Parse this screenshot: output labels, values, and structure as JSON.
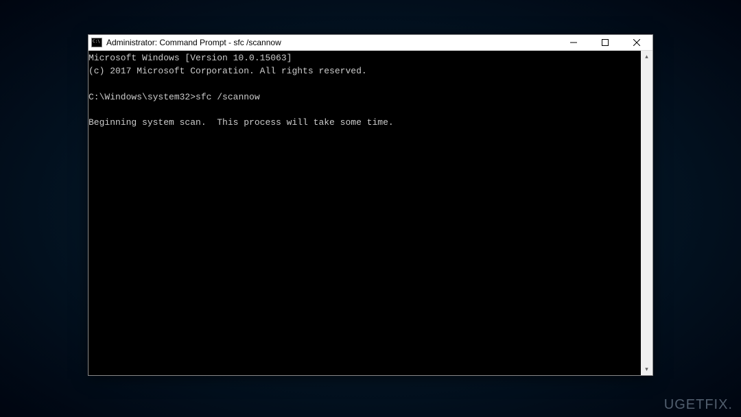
{
  "window": {
    "title": "Administrator: Command Prompt - sfc  /scannow"
  },
  "terminal": {
    "line1": "Microsoft Windows [Version 10.0.15063]",
    "line2": "(c) 2017 Microsoft Corporation. All rights reserved.",
    "blank1": "",
    "prompt": "C:\\Windows\\system32>",
    "command": "sfc /scannow",
    "blank2": "",
    "line3": "Beginning system scan.  This process will take some time."
  },
  "watermark": "UGETFIX."
}
